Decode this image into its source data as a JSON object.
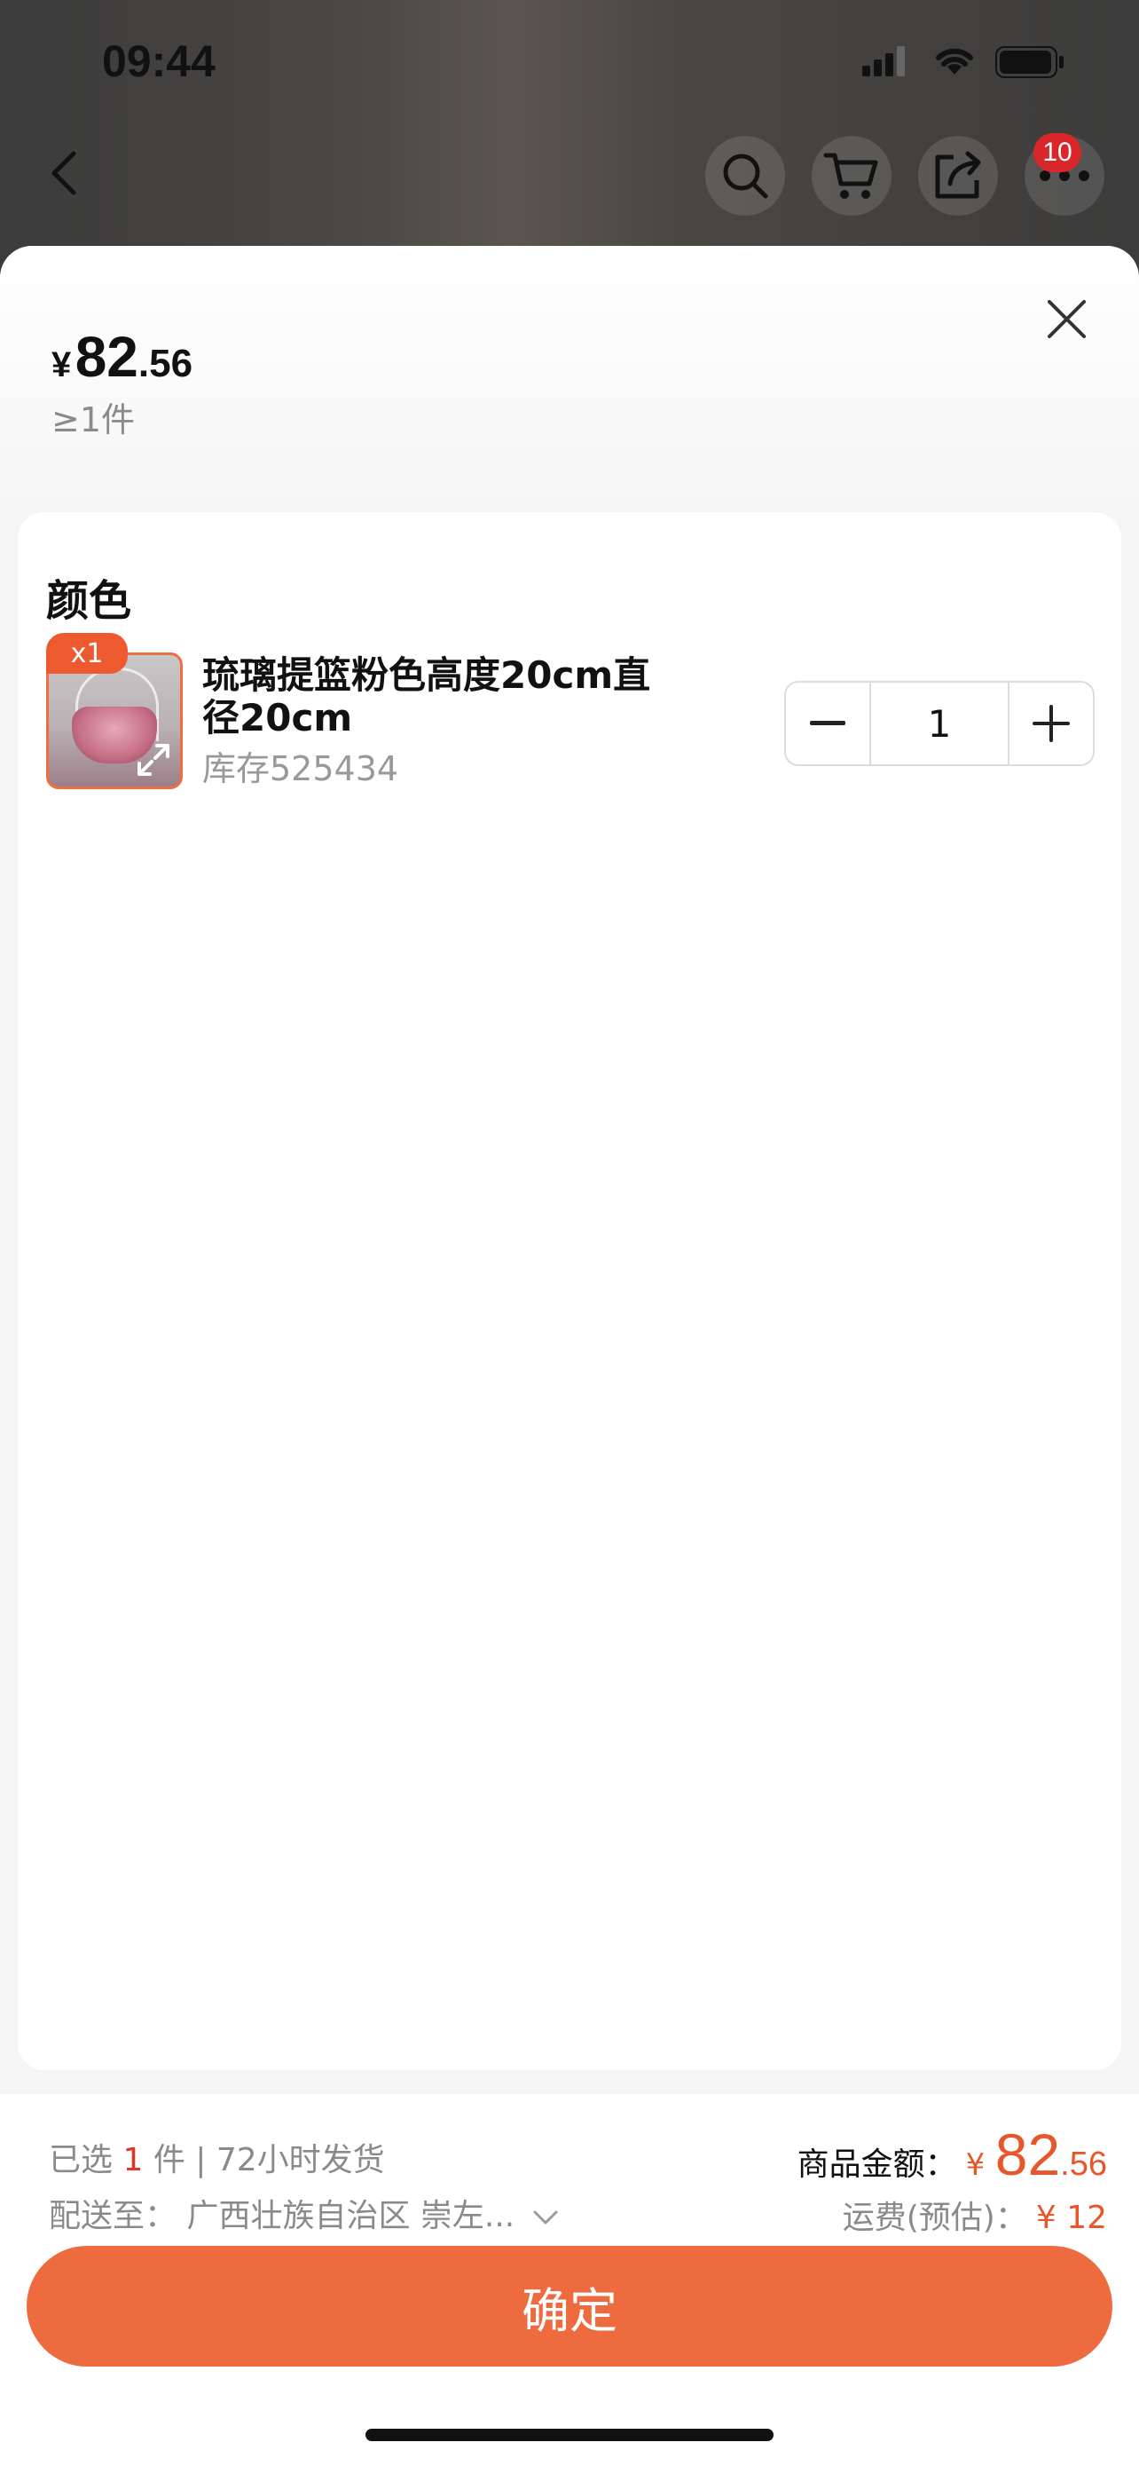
{
  "status": {
    "time": "09:44"
  },
  "nav": {
    "cart_badge": "10"
  },
  "sheet": {
    "price": {
      "currency": "¥",
      "integer": "82",
      "decimal": ".56"
    },
    "moq": "≥1件",
    "section_title": "颜色",
    "item": {
      "qty_tag": "x1",
      "name": "琉璃提篮粉色高度20cm直径20cm",
      "stock": "库存525434",
      "quantity": "1"
    }
  },
  "footer": {
    "selected_prefix": "已选",
    "selected_count": "1",
    "selected_suffix": "件 | 72小时发货",
    "ship_to_label": "配送至：",
    "ship_to_value": "广西壮族自治区 崇左...",
    "amount_label": "商品金额：",
    "amount_currency": "¥",
    "amount_integer": "82",
    "amount_decimal": ".56",
    "freight_label": "运费(预估)：",
    "freight_value": "¥ 12"
  },
  "confirm_label": "确定",
  "colors": {
    "accent": "#ee6b3f",
    "price_red": "#e8562b",
    "badge_red": "#d8262b"
  }
}
